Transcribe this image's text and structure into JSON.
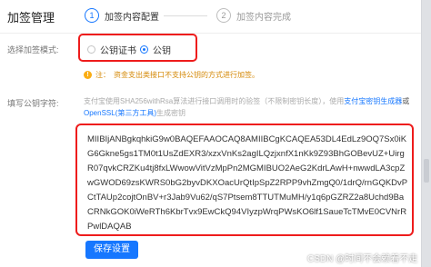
{
  "dialog": {
    "title": "加签管理",
    "steps": [
      {
        "num": "1",
        "label": "加签内容配置"
      },
      {
        "num": "2",
        "label": "加签内容完成"
      }
    ],
    "close": "×"
  },
  "form": {
    "mode_label": "选择加签模式:",
    "modes": [
      {
        "label": "公钥证书",
        "selected": false
      },
      {
        "label": "公钥",
        "selected": true
      }
    ],
    "notice_prefix": "注：",
    "notice_text": "资金支出类接口不支持公钥的方式进行加签。",
    "key_label": "填写公钥字符:",
    "desc_part1": "支付宝使用SHA256withRsa算法进行接口调用时的验签（不限制密钥长度），使用",
    "desc_link1": "支付宝密钥生成器",
    "desc_part2": "或",
    "desc_link2": "OpenSSL(第三方工具)",
    "desc_part3": "生成密钥",
    "public_key": "MIIBIjANBgkqhkiG9w0BAQEFAAOCAQ8AMIIBCgKCAQEA53DL4EdLz9OQ7Sx0iKG6Gkne5gs1TM0t1UsZdEXR3/xzxVnKs2agILQzjxnfX1nKk9Z93BhGOBevUZ+UirgR07qvkCRZKu4tj8fxLWwowVitVzMpPn2MGMIBUO2AeG2KdrLAwH+nwwdLA3cpZwGWOD69zsKWRS0bG2byvDKXOacUrQtIpSpZ2RPP9vhZmgQ0/1drQ/rnGQKDvPCtTAUp2cojtOnBV+r3Jab9Vu62/qS7Ptsem8TTUTMuMH/y1q6pGZRZ2a8Uchd9BaCRNkGOK0iWeRTh6KbrTvx9EwCkQ94VIyzpWrqPWsKO6lf1SaueTcTMvE0CVNrRPwlDAQAB",
    "save_button": "保存设置"
  },
  "watermark": "CSDN @时间不会赖着不走"
}
